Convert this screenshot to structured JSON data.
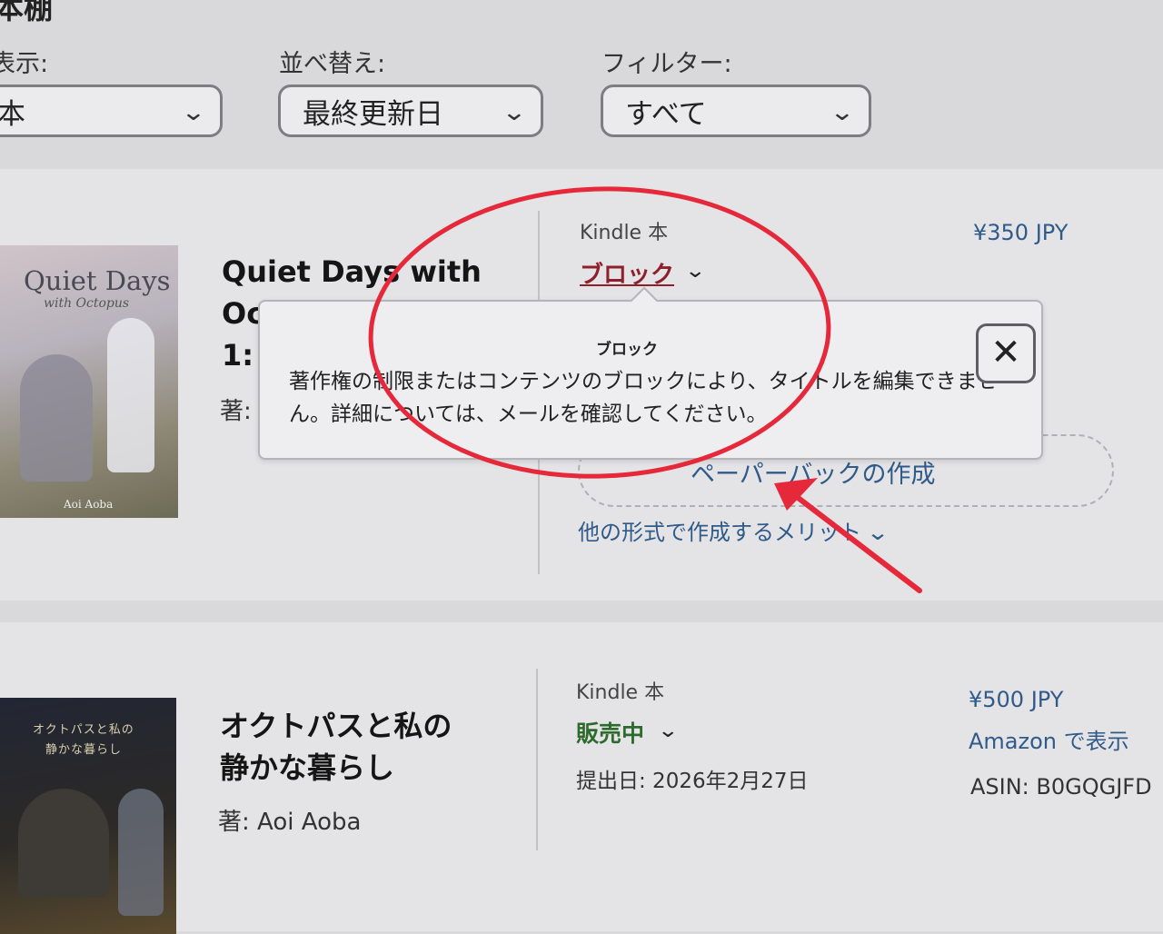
{
  "page": {
    "title": "本棚"
  },
  "filters": {
    "display": {
      "label": "表示:",
      "value": "本"
    },
    "sort": {
      "label": "並べ替え:",
      "value": "最終更新日"
    },
    "filter": {
      "label": "フィルター:",
      "value": "すべて"
    }
  },
  "books": [
    {
      "cover": {
        "title": "Quiet Days",
        "subtitle": "with Octopus",
        "author": "Aoi Aoba"
      },
      "title_line1": "Quiet Days with",
      "title_line2": "Oc",
      "title_line3": "1:",
      "author_prefix": "著:",
      "format": "Kindle 本",
      "status": "ブロック",
      "price": "¥350 JPY",
      "paperback_link": "ペーパーバックの作成",
      "benefits_link": "他の形式で作成するメリット"
    },
    {
      "cover": {
        "title": "オクトパスと私の",
        "subtitle": "静かな暮らし"
      },
      "title_line1": "オクトパスと私の",
      "title_line2": "静かな暮らし",
      "author": "著: Aoi Aoba",
      "format": "Kindle 本",
      "status": "販売中",
      "submitted": "提出日: 2026年2月27日",
      "price": "¥500 JPY",
      "amazon_link": "Amazon で表示",
      "asin": "ASIN: B0GQGJFD"
    }
  ],
  "popover": {
    "title": "ブロック",
    "body": "著作権の制限またはコンテンツのブロックにより、タイトルを編集できません。詳細については、メールを確認してください。",
    "close_label": "✕"
  },
  "icons": {
    "chevron": "chevron-down-icon",
    "close": "close-icon"
  },
  "colors": {
    "blocked": "#8e1f2b",
    "live": "#2d6a2d",
    "link": "#2f5a8a",
    "annotation": "#e5283a"
  }
}
